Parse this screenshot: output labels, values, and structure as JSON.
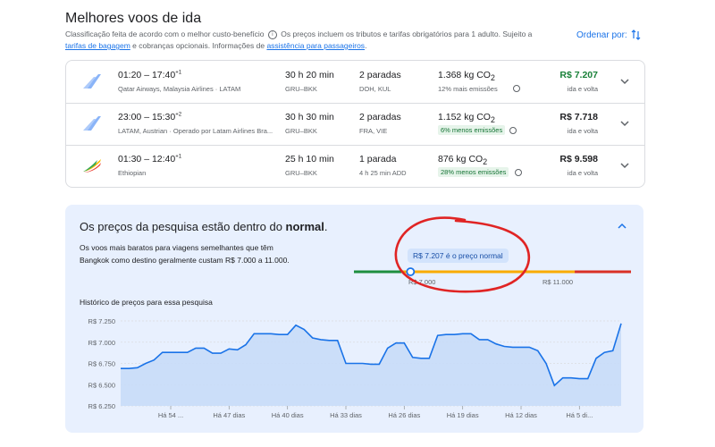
{
  "header": {
    "title": "Melhores voos de ida",
    "info_part1": "Classificação feita de acordo com o melhor custo-benefício",
    "info_part2": "Os preços incluem os tributos e tarifas obrigatórios para 1 adulto. Sujeito a",
    "info_link1": "tarifas de bagagem",
    "info_part3": "e cobranças opcionais. Informações de",
    "info_link2": "assistência para passageiros",
    "info_end": ".",
    "sort_label": "Ordenar por:"
  },
  "flights": [
    {
      "times": "01:20 – 17:40",
      "plus": "+1",
      "airline": "Qatar Airways, Malaysia Airlines · LATAM",
      "duration": "30 h 20 min",
      "route": "GRU–BKK",
      "stops": "2 paradas",
      "stop_detail": "DOH, KUL",
      "co2": "1.368 kg CO",
      "co2_sub": "2",
      "emissions": "12% mais emissões",
      "emissions_type": "neutral",
      "price": "R$ 7.207",
      "price_color": "#188038",
      "trip": "ida e volta"
    },
    {
      "times": "23:00 – 15:30",
      "plus": "+2",
      "airline": "LATAM, Austrian · Operado por Latam Airlines Bra...",
      "duration": "30 h 30 min",
      "route": "GRU–BKK",
      "stops": "2 paradas",
      "stop_detail": "FRA, VIE",
      "co2": "1.152 kg CO",
      "co2_sub": "2",
      "emissions": "6% menos emissões",
      "emissions_type": "green",
      "price": "R$ 7.718",
      "price_color": "#202124",
      "trip": "ida e volta"
    },
    {
      "times": "01:30 – 12:40",
      "plus": "+1",
      "airline": "Ethiopian",
      "duration": "25 h 10 min",
      "route": "GRU–BKK",
      "stops": "1 parada",
      "stop_detail": "4 h 25 min ADD",
      "co2": "876 kg CO",
      "co2_sub": "2",
      "emissions": "28% menos emissões",
      "emissions_type": "green",
      "price": "R$ 9.598",
      "price_color": "#202124",
      "trip": "ida e volta"
    }
  ],
  "insight": {
    "title_pre": "Os preços da pesquisa estão dentro do ",
    "title_bold": "normal",
    "title_post": ".",
    "description": "Os voos mais baratos para viagens semelhantes que têm Bangkok como destino geralmente custam R$ 7.000 a 11.000.",
    "badge": "R$ 7.207 é o preço normal",
    "range_low": "R$ 7.000",
    "range_high": "R$ 11.000",
    "history_label": "Histórico de preços para essa pesquisa"
  },
  "chart_data": {
    "type": "area",
    "y_ticks": [
      "R$ 7.250",
      "R$ 7.000",
      "R$ 6.750",
      "R$ 6.500",
      "R$ 6.250"
    ],
    "ylim": [
      6250,
      7250
    ],
    "x_ticks": [
      "Há 54 ...",
      "Há 47 dias",
      "Há 40 dias",
      "Há 33 dias",
      "Há 26 dias",
      "Há 19 dias",
      "Há 12 dias",
      "Há 5 di..."
    ],
    "x_tick_positions": [
      54,
      47,
      40,
      33,
      26,
      19,
      12,
      5
    ],
    "x": [
      60,
      59,
      58,
      57,
      56,
      55,
      54,
      53,
      52,
      51,
      50,
      49,
      48,
      47,
      46,
      45,
      44,
      43,
      42,
      41,
      40,
      39,
      38,
      37,
      36,
      35,
      34,
      33,
      32,
      31,
      30,
      29,
      28,
      27,
      26,
      25,
      24,
      23,
      22,
      21,
      20,
      19,
      18,
      17,
      16,
      15,
      14,
      13,
      12,
      11,
      10,
      9,
      8,
      7,
      6,
      5,
      4,
      3,
      2,
      1,
      0
    ],
    "values": [
      6690,
      6690,
      6700,
      6750,
      6790,
      6880,
      6880,
      6880,
      6880,
      6930,
      6930,
      6870,
      6870,
      6920,
      6910,
      6970,
      7100,
      7100,
      7100,
      7090,
      7090,
      7200,
      7150,
      7050,
      7030,
      7020,
      7020,
      6750,
      6750,
      6750,
      6740,
      6740,
      6930,
      6990,
      6990,
      6820,
      6810,
      6810,
      7080,
      7090,
      7090,
      7100,
      7100,
      7030,
      7030,
      6980,
      6950,
      6940,
      6940,
      6940,
      6900,
      6750,
      6490,
      6580,
      6580,
      6570,
      6570,
      6810,
      6880,
      6900,
      7220
    ],
    "line_color": "#1a73e8",
    "fill_color": "#c8dcf8",
    "range_bar": {
      "min": 5900,
      "max": 12300,
      "low": 7000,
      "high": 11000,
      "marker": 7207,
      "colors": {
        "low": "#1e8e3e",
        "mid": "#f9ab00",
        "high": "#d93025"
      }
    }
  }
}
